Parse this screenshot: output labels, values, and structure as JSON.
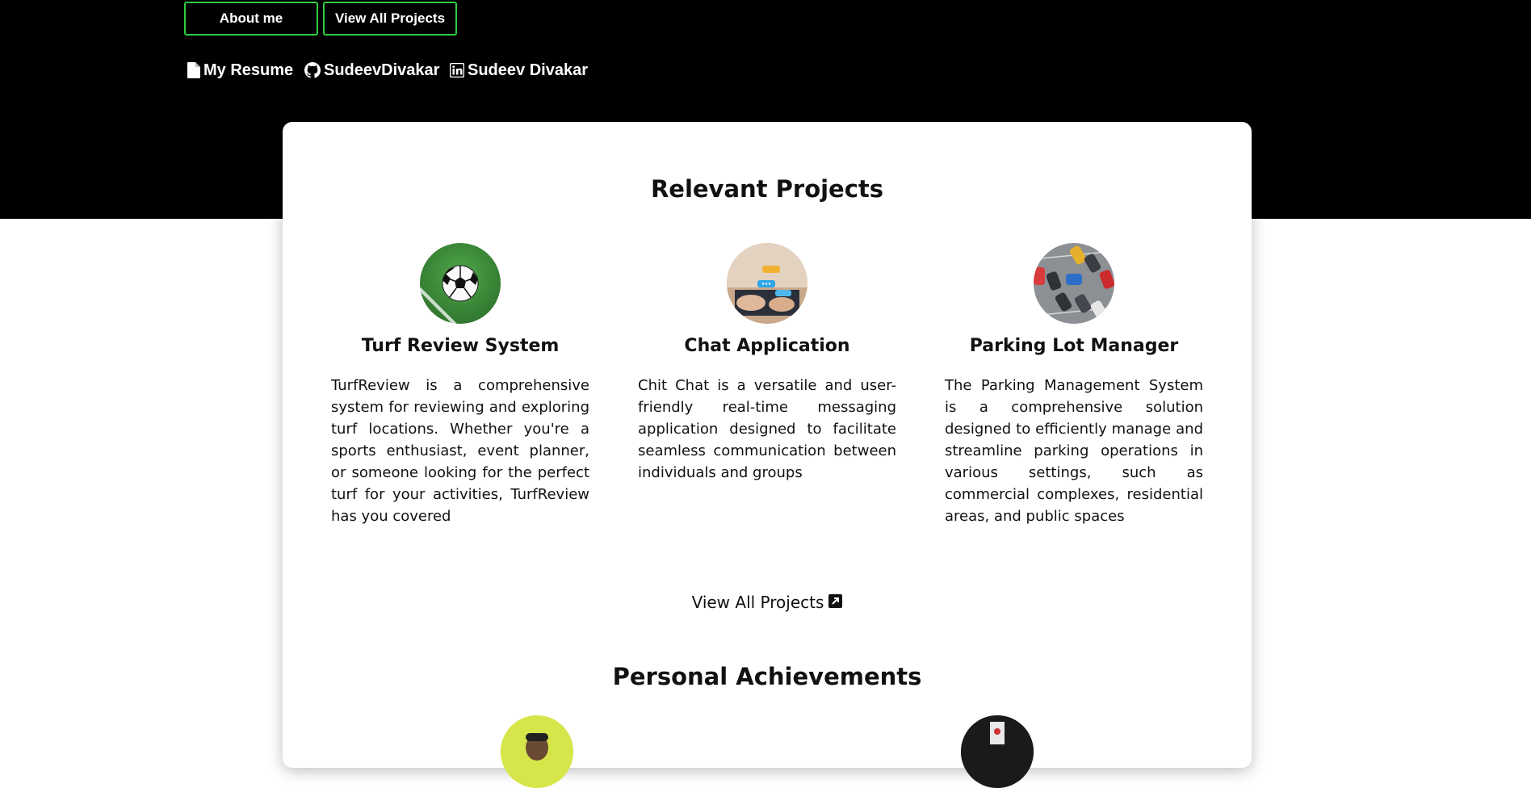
{
  "nav": {
    "about_label": "About me",
    "projects_label": "View All Projects"
  },
  "social": {
    "resume_label": "My Resume",
    "github_label": "SudeevDivakar",
    "linkedin_label": "Sudeev Divakar"
  },
  "projects_section": {
    "title": "Relevant Projects",
    "items": [
      {
        "title": "Turf Review System",
        "description": "TurfReview is a comprehensive system for reviewing and exploring turf locations. Whether you're a sports enthusiast, event planner, or someone looking for the perfect turf for your activities, TurfReview has you covered",
        "icon": "soccer-ball-icon"
      },
      {
        "title": "Chat Application",
        "description": "Chit Chat is a versatile and user-friendly real-time messaging application designed to facilitate seamless communication between individuals and groups",
        "icon": "chat-laptop-icon"
      },
      {
        "title": "Parking Lot Manager",
        "description": "The Parking Management System is a comprehensive solution designed to efficiently manage and streamline parking operations in various settings, such as commercial complexes, residential areas, and public spaces",
        "icon": "parking-lot-icon"
      }
    ],
    "view_all_label": "View All Projects"
  },
  "achievements_section": {
    "title": "Personal Achievements"
  },
  "colors": {
    "hero_background": "#000000",
    "button_border": "#2ecc40",
    "card_background": "#ffffff"
  }
}
